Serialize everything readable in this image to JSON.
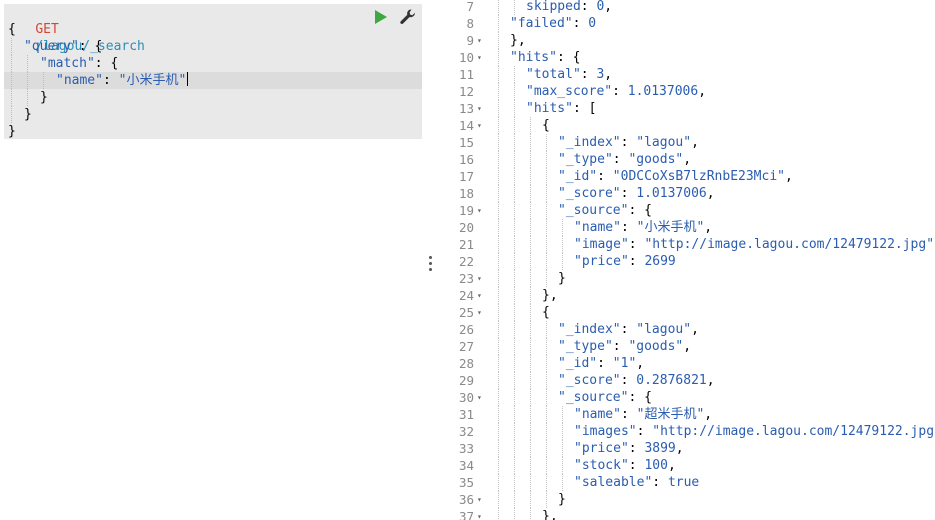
{
  "request": {
    "method": "GET",
    "path": "/lagou/_search",
    "lines": [
      {
        "indent": 0,
        "tokens": [
          {
            "t": "punc",
            "v": "{"
          }
        ]
      },
      {
        "indent": 1,
        "tokens": [
          {
            "t": "key",
            "v": "\"query\""
          },
          {
            "t": "punc",
            "v": ": {"
          }
        ]
      },
      {
        "indent": 2,
        "tokens": [
          {
            "t": "key",
            "v": "\"match\""
          },
          {
            "t": "punc",
            "v": ": {"
          }
        ]
      },
      {
        "indent": 3,
        "tokens": [
          {
            "t": "key",
            "v": "\"name\""
          },
          {
            "t": "punc",
            "v": ": "
          },
          {
            "t": "str",
            "v": "\"小米手机\""
          }
        ]
      },
      {
        "indent": 2,
        "tokens": [
          {
            "t": "punc",
            "v": "}"
          }
        ]
      },
      {
        "indent": 1,
        "tokens": [
          {
            "t": "punc",
            "v": "}"
          }
        ]
      },
      {
        "indent": 0,
        "tokens": [
          {
            "t": "punc",
            "v": "}"
          }
        ]
      }
    ]
  },
  "toolbar": {
    "play_icon": "play-icon",
    "wrench_icon": "wrench-icon",
    "play_color": "#3fa73f"
  },
  "response": {
    "lines": [
      {
        "n": 7,
        "fold": false,
        "indent": 2,
        "tokens": [
          {
            "t": "key",
            "v": "skipped"
          },
          {
            "t": "punc",
            "v": ": "
          },
          {
            "t": "num",
            "v": "0"
          },
          {
            "t": "punc",
            "v": ","
          }
        ]
      },
      {
        "n": 8,
        "fold": false,
        "indent": 1,
        "tokens": [
          {
            "t": "key",
            "v": "\"failed\""
          },
          {
            "t": "punc",
            "v": ": "
          },
          {
            "t": "num",
            "v": "0"
          }
        ]
      },
      {
        "n": 9,
        "fold": true,
        "indent": 1,
        "tokens": [
          {
            "t": "punc",
            "v": "},"
          }
        ]
      },
      {
        "n": 10,
        "fold": true,
        "indent": 1,
        "tokens": [
          {
            "t": "key",
            "v": "\"hits\""
          },
          {
            "t": "punc",
            "v": ": {"
          }
        ]
      },
      {
        "n": 11,
        "fold": false,
        "indent": 2,
        "tokens": [
          {
            "t": "key",
            "v": "\"total\""
          },
          {
            "t": "punc",
            "v": ": "
          },
          {
            "t": "num",
            "v": "3"
          },
          {
            "t": "punc",
            "v": ","
          }
        ]
      },
      {
        "n": 12,
        "fold": false,
        "indent": 2,
        "tokens": [
          {
            "t": "key",
            "v": "\"max_score\""
          },
          {
            "t": "punc",
            "v": ": "
          },
          {
            "t": "num",
            "v": "1.0137006"
          },
          {
            "t": "punc",
            "v": ","
          }
        ]
      },
      {
        "n": 13,
        "fold": true,
        "indent": 2,
        "tokens": [
          {
            "t": "key",
            "v": "\"hits\""
          },
          {
            "t": "punc",
            "v": ": ["
          }
        ]
      },
      {
        "n": 14,
        "fold": true,
        "indent": 3,
        "tokens": [
          {
            "t": "punc",
            "v": "{"
          }
        ]
      },
      {
        "n": 15,
        "fold": false,
        "indent": 4,
        "tokens": [
          {
            "t": "key",
            "v": "\"_index\""
          },
          {
            "t": "punc",
            "v": ": "
          },
          {
            "t": "str",
            "v": "\"lagou\""
          },
          {
            "t": "punc",
            "v": ","
          }
        ]
      },
      {
        "n": 16,
        "fold": false,
        "indent": 4,
        "tokens": [
          {
            "t": "key",
            "v": "\"_type\""
          },
          {
            "t": "punc",
            "v": ": "
          },
          {
            "t": "str",
            "v": "\"goods\""
          },
          {
            "t": "punc",
            "v": ","
          }
        ]
      },
      {
        "n": 17,
        "fold": false,
        "indent": 4,
        "tokens": [
          {
            "t": "key",
            "v": "\"_id\""
          },
          {
            "t": "punc",
            "v": ": "
          },
          {
            "t": "str",
            "v": "\"0DCCoXsB7lzRnbE23Mci\""
          },
          {
            "t": "punc",
            "v": ","
          }
        ]
      },
      {
        "n": 18,
        "fold": false,
        "indent": 4,
        "tokens": [
          {
            "t": "key",
            "v": "\"_score\""
          },
          {
            "t": "punc",
            "v": ": "
          },
          {
            "t": "num",
            "v": "1.0137006"
          },
          {
            "t": "punc",
            "v": ","
          }
        ]
      },
      {
        "n": 19,
        "fold": true,
        "indent": 4,
        "tokens": [
          {
            "t": "key",
            "v": "\"_source\""
          },
          {
            "t": "punc",
            "v": ": {"
          }
        ]
      },
      {
        "n": 20,
        "fold": false,
        "indent": 5,
        "tokens": [
          {
            "t": "key",
            "v": "\"name\""
          },
          {
            "t": "punc",
            "v": ": "
          },
          {
            "t": "str",
            "v": "\"小米手机\""
          },
          {
            "t": "punc",
            "v": ","
          }
        ]
      },
      {
        "n": 21,
        "fold": false,
        "indent": 5,
        "tokens": [
          {
            "t": "key",
            "v": "\"image\""
          },
          {
            "t": "punc",
            "v": ": "
          },
          {
            "t": "str",
            "v": "\"http://image.lagou.com/12479122.jpg\""
          }
        ]
      },
      {
        "n": 22,
        "fold": false,
        "indent": 5,
        "tokens": [
          {
            "t": "key",
            "v": "\"price\""
          },
          {
            "t": "punc",
            "v": ": "
          },
          {
            "t": "num",
            "v": "2699"
          }
        ]
      },
      {
        "n": 23,
        "fold": true,
        "indent": 4,
        "tokens": [
          {
            "t": "punc",
            "v": "}"
          }
        ]
      },
      {
        "n": 24,
        "fold": true,
        "indent": 3,
        "tokens": [
          {
            "t": "punc",
            "v": "},"
          }
        ]
      },
      {
        "n": 25,
        "fold": true,
        "indent": 3,
        "tokens": [
          {
            "t": "punc",
            "v": "{"
          }
        ]
      },
      {
        "n": 26,
        "fold": false,
        "indent": 4,
        "tokens": [
          {
            "t": "key",
            "v": "\"_index\""
          },
          {
            "t": "punc",
            "v": ": "
          },
          {
            "t": "str",
            "v": "\"lagou\""
          },
          {
            "t": "punc",
            "v": ","
          }
        ]
      },
      {
        "n": 27,
        "fold": false,
        "indent": 4,
        "tokens": [
          {
            "t": "key",
            "v": "\"_type\""
          },
          {
            "t": "punc",
            "v": ": "
          },
          {
            "t": "str",
            "v": "\"goods\""
          },
          {
            "t": "punc",
            "v": ","
          }
        ]
      },
      {
        "n": 28,
        "fold": false,
        "indent": 4,
        "tokens": [
          {
            "t": "key",
            "v": "\"_id\""
          },
          {
            "t": "punc",
            "v": ": "
          },
          {
            "t": "str",
            "v": "\"1\""
          },
          {
            "t": "punc",
            "v": ","
          }
        ]
      },
      {
        "n": 29,
        "fold": false,
        "indent": 4,
        "tokens": [
          {
            "t": "key",
            "v": "\"_score\""
          },
          {
            "t": "punc",
            "v": ": "
          },
          {
            "t": "num",
            "v": "0.2876821"
          },
          {
            "t": "punc",
            "v": ","
          }
        ]
      },
      {
        "n": 30,
        "fold": true,
        "indent": 4,
        "tokens": [
          {
            "t": "key",
            "v": "\"_source\""
          },
          {
            "t": "punc",
            "v": ": {"
          }
        ]
      },
      {
        "n": 31,
        "fold": false,
        "indent": 5,
        "tokens": [
          {
            "t": "key",
            "v": "\"name\""
          },
          {
            "t": "punc",
            "v": ": "
          },
          {
            "t": "str",
            "v": "\"超米手机\""
          },
          {
            "t": "punc",
            "v": ","
          }
        ]
      },
      {
        "n": 32,
        "fold": false,
        "indent": 5,
        "tokens": [
          {
            "t": "key",
            "v": "\"images\""
          },
          {
            "t": "punc",
            "v": ": "
          },
          {
            "t": "str",
            "v": "\"http://image.lagou.com/12479122.jpg\""
          },
          {
            "t": "punc",
            "v": ","
          }
        ]
      },
      {
        "n": 33,
        "fold": false,
        "indent": 5,
        "tokens": [
          {
            "t": "key",
            "v": "\"price\""
          },
          {
            "t": "punc",
            "v": ": "
          },
          {
            "t": "num",
            "v": "3899"
          },
          {
            "t": "punc",
            "v": ","
          }
        ]
      },
      {
        "n": 34,
        "fold": false,
        "indent": 5,
        "tokens": [
          {
            "t": "key",
            "v": "\"stock\""
          },
          {
            "t": "punc",
            "v": ": "
          },
          {
            "t": "num",
            "v": "100"
          },
          {
            "t": "punc",
            "v": ","
          }
        ]
      },
      {
        "n": 35,
        "fold": false,
        "indent": 5,
        "tokens": [
          {
            "t": "key",
            "v": "\"saleable\""
          },
          {
            "t": "punc",
            "v": ": "
          },
          {
            "t": "bool",
            "v": "true"
          }
        ]
      },
      {
        "n": 36,
        "fold": true,
        "indent": 4,
        "tokens": [
          {
            "t": "punc",
            "v": "}"
          }
        ]
      },
      {
        "n": 37,
        "fold": true,
        "indent": 3,
        "tokens": [
          {
            "t": "punc",
            "v": "},"
          }
        ]
      }
    ]
  }
}
